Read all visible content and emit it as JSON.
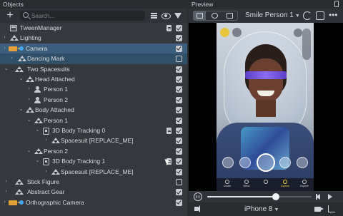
{
  "objects_panel": {
    "title": "Objects",
    "add_label": "+",
    "search": {
      "placeholder": "Search..."
    }
  },
  "tree": [
    {
      "label": "TweenManager",
      "icon": "scene-object-icon",
      "checked": true,
      "doc": true
    },
    {
      "label": "Lighting",
      "icon": "light-icon",
      "checked": true
    },
    {
      "label": "Camera",
      "icon": "camera-icon",
      "checked": true,
      "selected": true
    },
    {
      "label": "Dancing Mark",
      "icon": "person-group-icon",
      "checked": false,
      "selected": true
    },
    {
      "label": "Two Spacesuits",
      "icon": "person-group-icon",
      "checked": true
    },
    {
      "label": "Head Attached",
      "icon": "person-group-icon",
      "checked": true
    },
    {
      "label": "Person 1",
      "icon": "head-binding-icon",
      "checked": true
    },
    {
      "label": "Person 2",
      "icon": "head-binding-icon",
      "checked": true
    },
    {
      "label": "Body Attached",
      "icon": "person-group-icon",
      "checked": true
    },
    {
      "label": "Person 1",
      "icon": "person-group-icon",
      "checked": true
    },
    {
      "label": "3D Body Tracking 0",
      "icon": "body-tracking-icon",
      "checked": true,
      "doc": true
    },
    {
      "label": "Spacesuit [REPLACE_ME]",
      "icon": "person-group-icon",
      "checked": true
    },
    {
      "label": "Person 2",
      "icon": "person-group-icon",
      "checked": true
    },
    {
      "label": "3D Body Tracking 1",
      "icon": "body-tracking-icon",
      "checked": true,
      "doc": true
    },
    {
      "label": "Spacesuit [REPLACE_ME]",
      "icon": "person-group-icon",
      "checked": true
    },
    {
      "label": "Stick Figure",
      "icon": "person-group-icon",
      "checked": false
    },
    {
      "label": "Abstract Gear",
      "icon": "person-group-icon",
      "checked": true
    },
    {
      "label": "Orthographic Camera",
      "icon": "camera-icon",
      "checked": true
    }
  ],
  "preview_panel": {
    "title": "Preview",
    "preset": "Smile Person 1",
    "device": "iPhone 8",
    "playback_progress": 0.66
  },
  "snap_ui": {
    "tabs": [
      "Create",
      "Blend",
      "",
      "Explore",
      "Explore"
    ],
    "active_tab": 3
  },
  "colors": {
    "selected_row": "#3b5e7c",
    "camera_icon": "#e2a03a",
    "object_dot": "#47a6e8",
    "background": "#2b2d31"
  }
}
